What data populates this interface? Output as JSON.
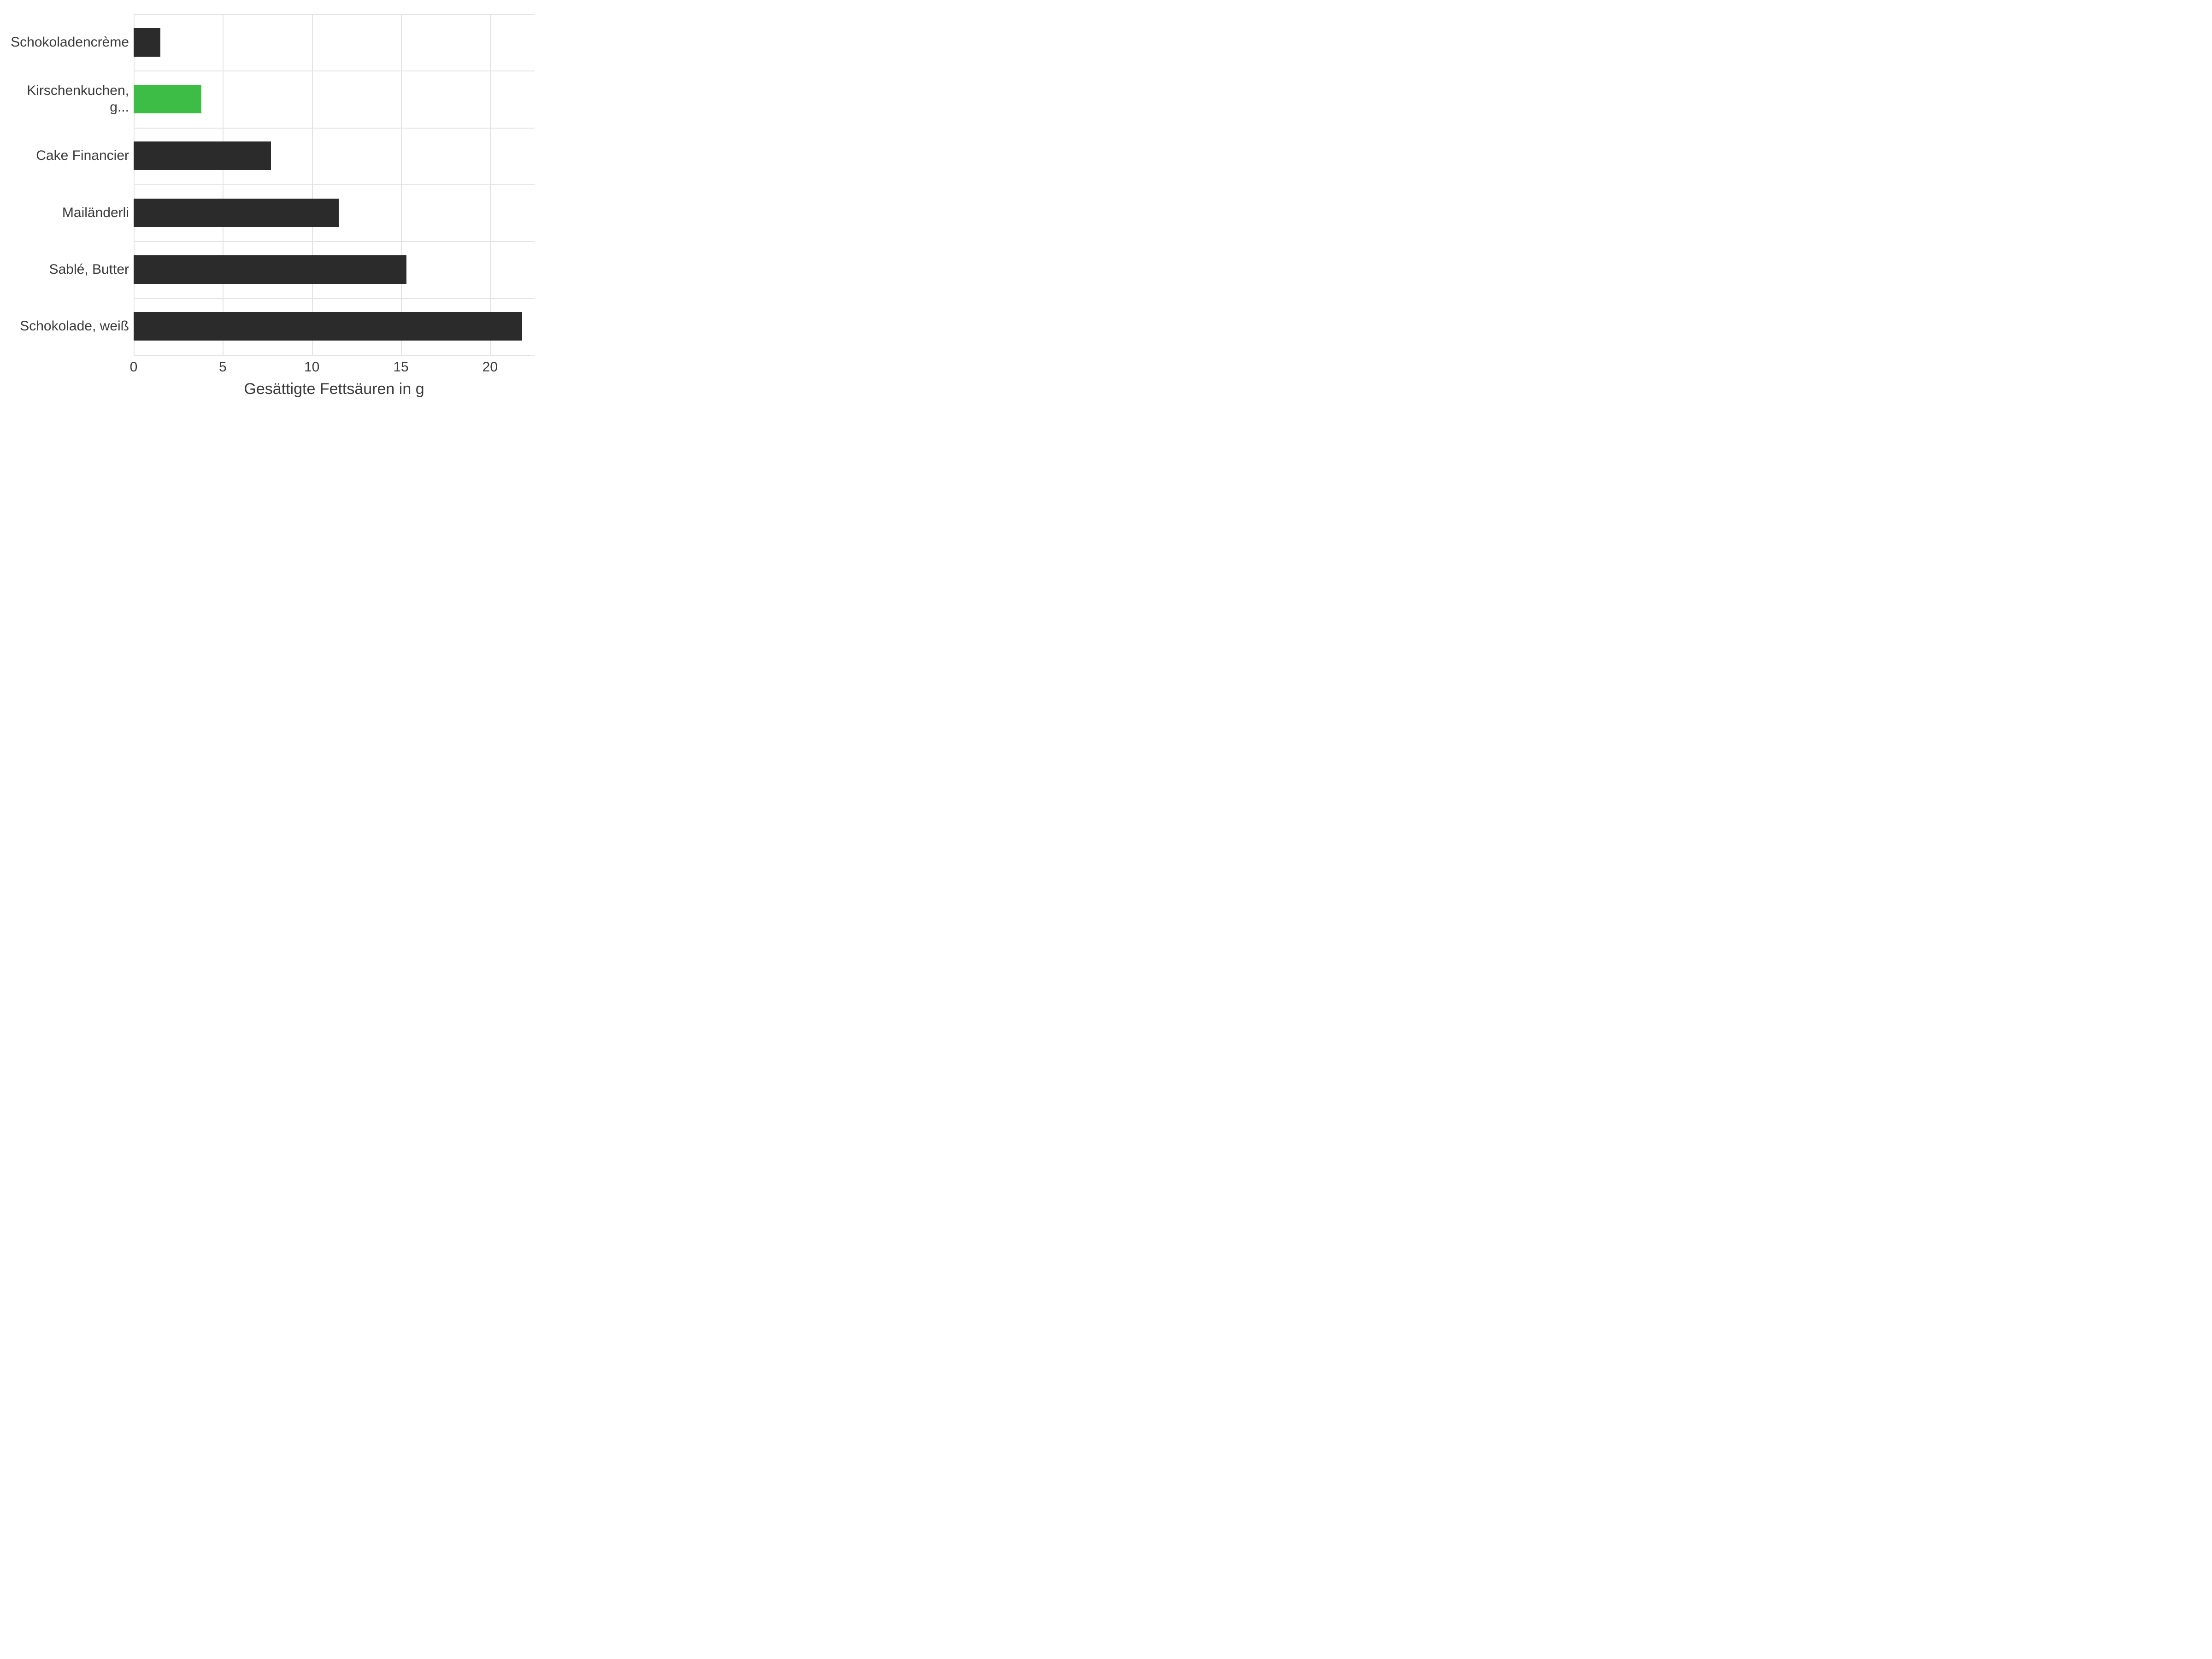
{
  "chart_data": {
    "type": "bar",
    "orientation": "horizontal",
    "categories": [
      "Schokoladencrème",
      "Kirschenkuchen, g...",
      "Cake Financier",
      "Mailänderli",
      "Sablé, Butter",
      "Schokolade, weiß"
    ],
    "values": [
      1.5,
      3.8,
      7.7,
      11.5,
      15.3,
      21.8
    ],
    "highlight_index": 1,
    "xlabel": "Gesättigte Fettsäuren in g",
    "ylabel": "",
    "title": "",
    "xlim": [
      0,
      22.5
    ],
    "x_ticks": [
      0,
      5,
      10,
      15,
      20
    ]
  },
  "colors": {
    "bar_default": "#2b2b2b",
    "bar_highlight": "#3ebd46",
    "grid": "#e4e4e4",
    "text": "#3a3a3a"
  }
}
